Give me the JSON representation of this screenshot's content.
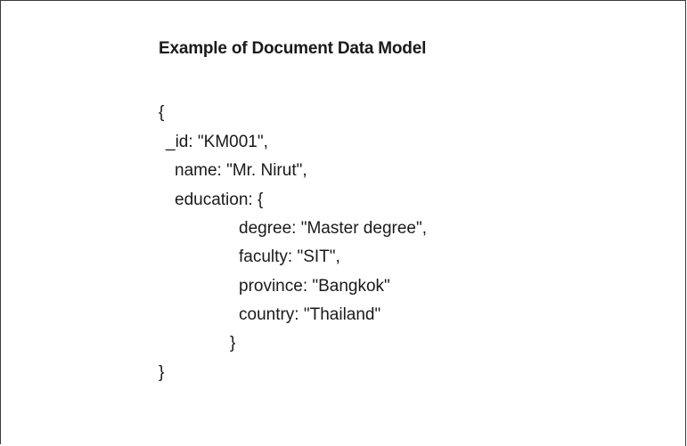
{
  "document": {
    "title": "Example of Document Data Model",
    "lines": [
      "{",
      "_id: \"KM001\",",
      "name: \"Mr. Nirut\",",
      "education: {",
      "degree: \"Master degree\",",
      "faculty: \"SIT\",",
      "province: \"Bangkok\"",
      "country: \"Thailand\"",
      "}",
      "}"
    ]
  }
}
